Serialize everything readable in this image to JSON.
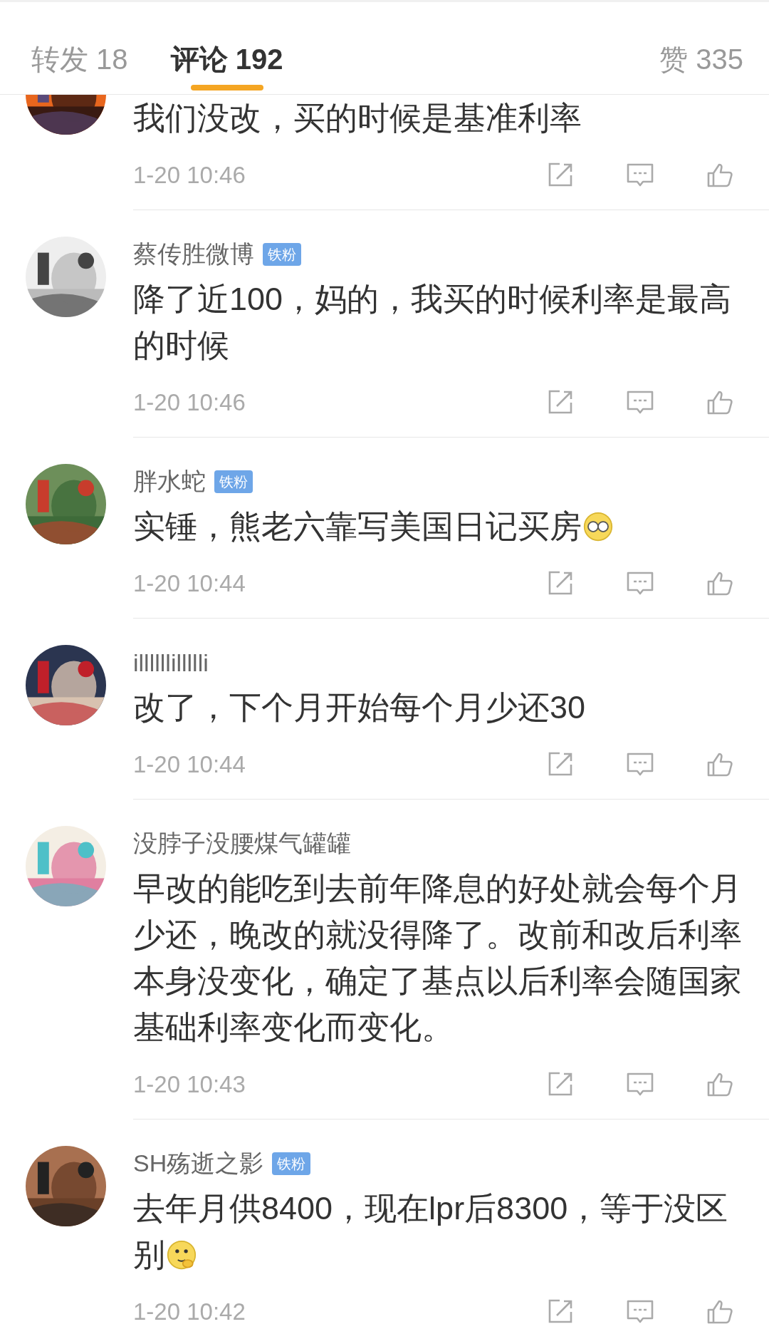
{
  "tabs": [
    {
      "label": "转发 18",
      "selected": false
    },
    {
      "label": "评论 192",
      "selected": true
    },
    {
      "label": "赞 335",
      "selected": false
    }
  ],
  "comments": [
    {
      "text": "我们没改，买的时候是基准利率",
      "time": "1-20 10:46"
    },
    {
      "name": "蔡传胜微博",
      "badge": "铁粉",
      "text": "降了近100，妈的，我买的时候利率是最高的时候",
      "time": "1-20 10:46"
    },
    {
      "name": "胖水蛇",
      "badge": "铁粉",
      "text": "实锤，熊老六靠写美国日记买房",
      "emoji": {
        "kind": "glasses"
      },
      "time": "1-20 10:44"
    },
    {
      "name": "illllllillllli",
      "text": "改了，下个月开始每个月少还30",
      "time": "1-20 10:44"
    },
    {
      "name": "没脖子没腰煤气罐罐",
      "text": "早改的能吃到去前年降息的好处就会每个月少还，晚改的就没得降了。改前和改后利率本身没变化，确定了基点以后利率会随国家基础利率变化而变化。",
      "time": "1-20 10:43"
    },
    {
      "name": "SH殇逝之影",
      "badge": "铁粉",
      "text": "去年月供8400，现在lpr后8300，等于没区别",
      "emoji": {
        "kind": "thinking"
      },
      "time": "1-20 10:42"
    }
  ]
}
